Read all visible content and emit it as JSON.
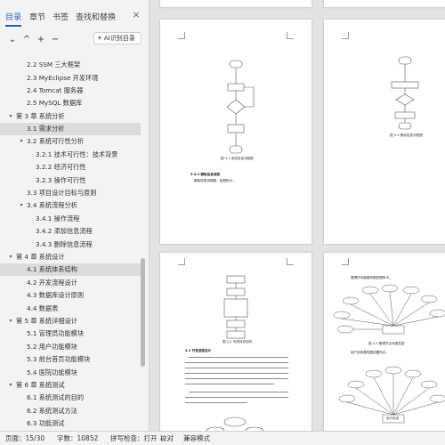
{
  "sidebar": {
    "tabs": [
      {
        "label": "目录"
      },
      {
        "label": "章节"
      },
      {
        "label": "书签"
      },
      {
        "label": "查找和替换"
      }
    ],
    "close_icon": "×",
    "toolbar": {
      "collapse_icon": "⌄",
      "up_icon": "^",
      "add_icon": "+",
      "remove_icon": "−",
      "ai_label": "AI识别目录"
    },
    "outline": [
      {
        "label": "2.2 SSM 三大框架"
      },
      {
        "label": "2.3 MyEclipse 开发环境"
      },
      {
        "label": "2.4 Tomcat 服务器"
      },
      {
        "label": "2.5 MySQL 数据库"
      },
      {
        "label": "第 3 章  系统分析"
      },
      {
        "label": "3.1 需求分析"
      },
      {
        "label": "3.2 系统可行性分析"
      },
      {
        "label": "3.2.1 技术可行性：技术背景"
      },
      {
        "label": "3.2.2 经济可行性"
      },
      {
        "label": "3.2.3 操作可行性"
      },
      {
        "label": "3.3 项目设计目标与原则"
      },
      {
        "label": "3.4 系统流程分析"
      },
      {
        "label": "3.4.1 操作流程"
      },
      {
        "label": "3.4.2 添加信息流程"
      },
      {
        "label": "3.4.3 删除信息流程"
      },
      {
        "label": "第 4 章  系统设计"
      },
      {
        "label": "4.1 系统体系结构"
      },
      {
        "label": "4.2 开发流程设计"
      },
      {
        "label": "4.3 数据库设计原则"
      },
      {
        "label": "4.4 数据表"
      },
      {
        "label": "第 5 章 系统详细设计"
      },
      {
        "label": "5.1 管理员功能模块"
      },
      {
        "label": "5.2 用户功能模块"
      },
      {
        "label": "5.3 前台首页功能模块"
      },
      {
        "label": "5.4 医院功能模块"
      },
      {
        "label": "第 6 章  系统测试"
      },
      {
        "label": "6.1 系统测试的目的"
      },
      {
        "label": "6.2 系统测试方法"
      },
      {
        "label": "6.3 功能测试"
      }
    ]
  },
  "document": {
    "page1": {
      "caption": "图 3-3 添加信息流程图",
      "heading": "3.4.3 删除信息流程",
      "body": "删除信息流程图，如图所示。"
    },
    "page2": {
      "caption": "图 3-4 删除信息流程图"
    },
    "page3": {
      "caption": "图 4-1 系统体系结构",
      "heading": "4.2 开发流程设计"
    },
    "page4": {
      "intro": "管理员功能模块图如图所示。",
      "caption": "图 4-3 管理员实体属性图",
      "intro2": "用户实体属性图如图所示。",
      "center_label": "用户信息"
    }
  },
  "statusbar": {
    "page": "页面：15/30",
    "words": "字数：10852",
    "spell": "拼写检查：打开",
    "spell_icon": "chevron-down-icon",
    "proof": "校对",
    "compat": "兼容模式"
  }
}
